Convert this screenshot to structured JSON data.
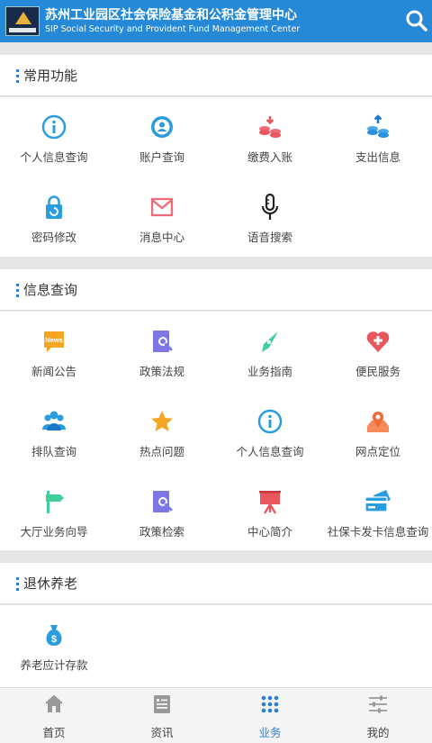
{
  "header": {
    "title_cn": "苏州工业园区社会保险基金和公积金管理中心",
    "title_en": "SIP Social Security and Provident Fund Management Center"
  },
  "sections": [
    {
      "title": "常用功能",
      "items": [
        {
          "label": "个人信息查询",
          "icon": "info-icon"
        },
        {
          "label": "账户查询",
          "icon": "account-icon"
        },
        {
          "label": "缴费入账",
          "icon": "coins-in-icon"
        },
        {
          "label": "支出信息",
          "icon": "coins-out-icon"
        },
        {
          "label": "密码修改",
          "icon": "lock-icon"
        },
        {
          "label": "消息中心",
          "icon": "mail-icon"
        },
        {
          "label": "语音搜索",
          "icon": "microphone-icon"
        }
      ]
    },
    {
      "title": "信息查询",
      "items": [
        {
          "label": "新闻公告",
          "icon": "news-icon",
          "badge": "News"
        },
        {
          "label": "政策法规",
          "icon": "document-search-icon"
        },
        {
          "label": "业务指南",
          "icon": "compass-icon"
        },
        {
          "label": "便民服务",
          "icon": "heart-plus-icon"
        },
        {
          "label": "排队查询",
          "icon": "people-icon"
        },
        {
          "label": "热点问题",
          "icon": "star-icon"
        },
        {
          "label": "个人信息查询",
          "icon": "info-icon"
        },
        {
          "label": "网点定位",
          "icon": "map-pin-icon"
        },
        {
          "label": "大厅业务向导",
          "icon": "signpost-icon"
        },
        {
          "label": "政策检索",
          "icon": "document-search-icon"
        },
        {
          "label": "中心简介",
          "icon": "presentation-icon"
        },
        {
          "label": "社保卡发卡信息查询",
          "icon": "card-icon"
        }
      ]
    },
    {
      "title": "退休养老",
      "items": [
        {
          "label": "养老应计存款",
          "icon": "money-bag-icon"
        }
      ]
    }
  ],
  "tabs": [
    {
      "label": "首页",
      "icon": "home-icon"
    },
    {
      "label": "资讯",
      "icon": "news-list-icon"
    },
    {
      "label": "业务",
      "icon": "grid-dots-icon",
      "active": true
    },
    {
      "label": "我的",
      "icon": "sliders-icon"
    }
  ],
  "colors": {
    "header": "#2689d8",
    "blue": "#2a9ce0",
    "red": "#e9565b",
    "pink": "#f06a78",
    "green": "#3fcf9a",
    "orange": "#f5a623",
    "purple": "#7d77e6",
    "tab_active": "#2a7fd4"
  }
}
